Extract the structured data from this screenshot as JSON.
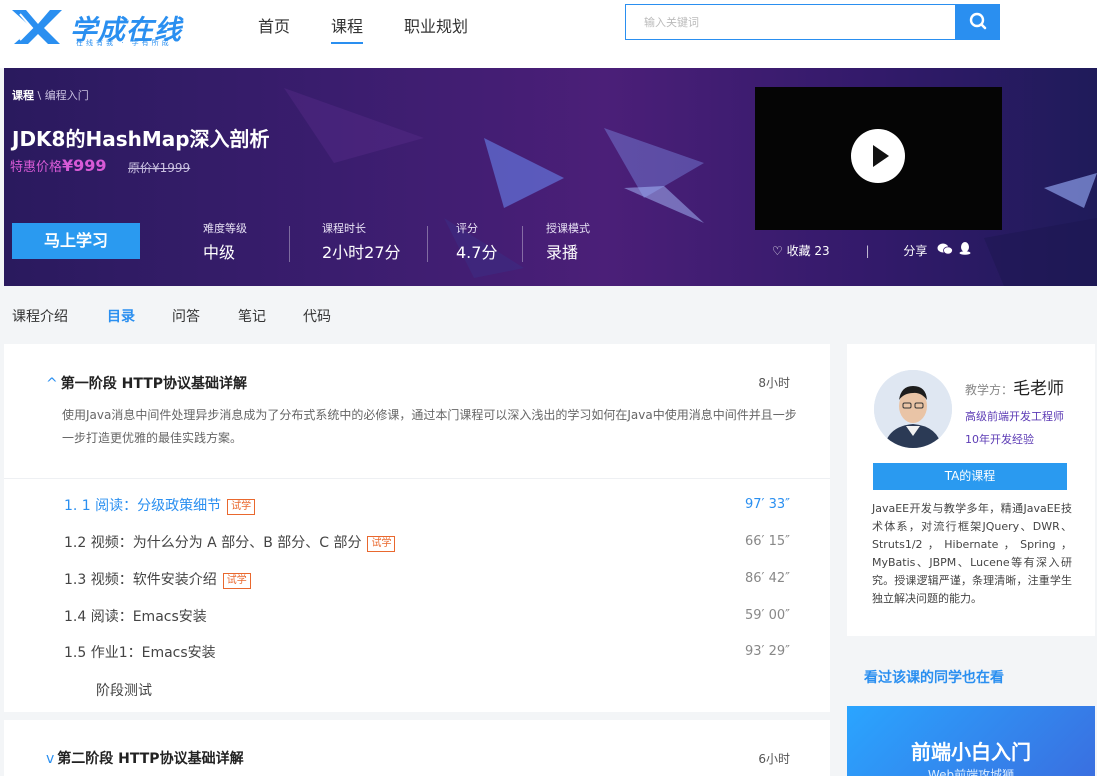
{
  "brand": {
    "name": "学成在线",
    "slogan": "在线有我 · 学有所成",
    "accent": "#2a8ff0"
  },
  "nav": {
    "items": [
      "首页",
      "课程",
      "职业规划"
    ],
    "active": "课程"
  },
  "search": {
    "placeholder": "输入关键词",
    "icon": "search-icon"
  },
  "course": {
    "breadcrumb": {
      "root": "课程",
      "sep": " \\ ",
      "current": "编程入门"
    },
    "title": "JDK8的HashMap深入剖析",
    "price_label": "特惠价格",
    "price_value": "¥999",
    "original_price": "原价¥1999",
    "learn_button": "马上学习",
    "stats": [
      {
        "label": "难度等级",
        "value": "中级"
      },
      {
        "label": "课程时长",
        "value": "2小时27分"
      },
      {
        "label": "评分",
        "value": "4.7分"
      },
      {
        "label": "授课模式",
        "value": "录播"
      }
    ],
    "favorite": "收藏 23",
    "actions_sep": "|",
    "share": "分享"
  },
  "tabs": {
    "items": [
      "课程介绍",
      "目录",
      "问答",
      "笔记",
      "代码"
    ],
    "active": "目录"
  },
  "chapters": [
    {
      "title": "第一阶段  HTTP协议基础详解",
      "duration": "8小时",
      "description": "使用Java消息中间件处理异步消息成为了分布式系统中的必修课，通过本门课程可以深入浅出的学习如何在Java中使用消息中间件并且一步一步打造更优雅的最佳实践方案。",
      "lessons": [
        {
          "title": "1. 1  阅读：分级政策细节",
          "trial": "试学",
          "time": "97′ 33″",
          "active": true
        },
        {
          "title": "1.2  视频：为什么分为 A 部分、B 部分、C 部分",
          "trial": "试学",
          "time": "66′ 15″",
          "active": false
        },
        {
          "title": "1.3  视频：软件安装介绍",
          "trial": "试学",
          "time": "86′ 42″",
          "active": false
        },
        {
          "title": "1.4  阅读：Emacs安装",
          "trial": "",
          "time": "59′ 00″",
          "active": false
        },
        {
          "title": "1.5  作业1：Emacs安装",
          "trial": "",
          "time": "93′ 29″",
          "active": false
        }
      ],
      "stage_test": "阶段测试"
    },
    {
      "title": "第二阶段  HTTP协议基础详解",
      "duration": "6小时"
    }
  ],
  "teacher": {
    "label": "教学方：",
    "name": "毛老师",
    "tags": [
      "高级前端开发工程师",
      "10年开发经验"
    ],
    "courses_button": "TA的课程",
    "bio": "JavaEE开发与教学多年，精通JavaEE技术体系，对流行框架JQuery、DWR、Struts1/2，Hibernate，Spring，MyBatis、JBPM、Lucene等有深入研究。授课逻辑严谨，条理清晰，注重学生独立解决问题的能力。"
  },
  "sidebar": {
    "related_heading": "看过该课的同学也在看",
    "promo_title": "前端小白入门",
    "promo_subtitle": "Web前端攻城狮"
  }
}
